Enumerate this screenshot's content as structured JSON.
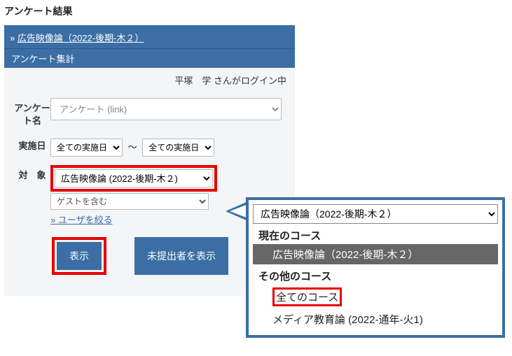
{
  "page": {
    "title": "アンケート結果"
  },
  "breadcrumb": {
    "prefix": "» ",
    "course_link": "広告映像論（2022-後期-木２）"
  },
  "subheader": {
    "label": "アンケート集計"
  },
  "login": {
    "status": "平塚　学 さんがログイン中"
  },
  "form": {
    "survey_label": "アンケート名",
    "survey_placeholder": "アンケート (link)",
    "date_label": "実施日",
    "date_from": "全ての実施日",
    "date_to": "全ての実施日",
    "date_sep": "～",
    "target_label": "対　象",
    "target_value": "広告映像論 (2022-後期-木２)",
    "guest_value": "ゲストを含む",
    "filter_link": "» ユーザを絞る",
    "show_btn": "表示",
    "unsubmitted_btn": "未提出者を表示"
  },
  "dropdown": {
    "top_value": "広告映像論（2022-後期-木２）",
    "group_current": "現在のコース",
    "current_option": "広告映像論（2022-後期-木２）",
    "group_other": "その他のコース",
    "all_courses": "全てのコース",
    "media_course": "メディア教育論 (2022-通年-火1)"
  }
}
